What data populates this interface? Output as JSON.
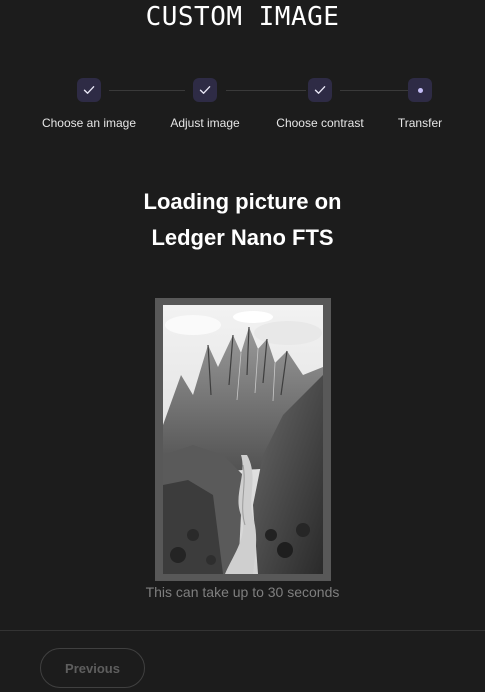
{
  "title": "CUSTOM IMAGE",
  "steps": [
    {
      "label": "Choose an image",
      "state": "done",
      "icon": "check-icon"
    },
    {
      "label": "Adjust image",
      "state": "done",
      "icon": "check-icon"
    },
    {
      "label": "Choose contrast",
      "state": "done",
      "icon": "check-icon"
    },
    {
      "label": "Transfer",
      "state": "current",
      "icon": "current-dot-icon"
    }
  ],
  "heading": {
    "line1": "Loading picture on",
    "line2": "Ledger Nano FTS"
  },
  "preview": {
    "description_icon": "mountain-trail-image"
  },
  "note": "This can take up to 30 seconds",
  "footer": {
    "previous_label": "Previous"
  },
  "colors": {
    "background": "#1c1c1c",
    "step_circle": "#2e2b45",
    "accent": "#c4bdf5",
    "muted_text": "#7f7f7f"
  }
}
